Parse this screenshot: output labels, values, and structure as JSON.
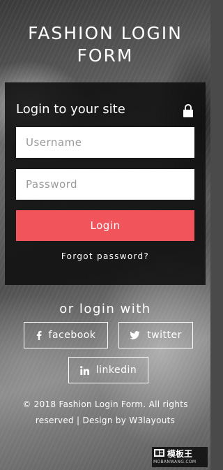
{
  "page": {
    "title": "FASHION LOGIN FORM"
  },
  "login_panel": {
    "heading": "Login to your site",
    "icon": "lock-icon",
    "username_placeholder": "Username",
    "password_placeholder": "Password",
    "login_label": "Login",
    "forgot_label": "Forgot password?"
  },
  "social": {
    "heading": "or login with",
    "facebook_label": "facebook",
    "twitter_label": "twitter",
    "linkedin_label": "linkedin"
  },
  "footer": {
    "copyright": "© 2018 Fashion Login Form. All rights reserved | Design by W3layouts"
  },
  "watermark": {
    "title": "模板王",
    "sub": "MOBANWANG.COM"
  },
  "colors": {
    "accent": "#f2545b",
    "panel_bg": "#0f0f0f"
  }
}
